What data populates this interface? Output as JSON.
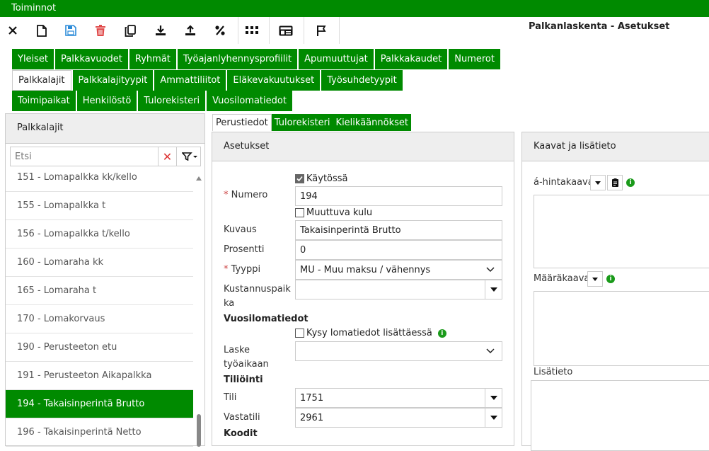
{
  "topbar": {
    "title": "Toiminnot"
  },
  "toolbar": {
    "page_title": "Palkanlaskenta - Asetukset",
    "icons": [
      "close-icon",
      "new-document-icon",
      "save-icon",
      "delete-icon",
      "copy-icon",
      "download-icon",
      "upload-icon",
      "percent-icon",
      "grid-icon",
      "id-card-icon",
      "flag-icon"
    ]
  },
  "nav": {
    "row1": [
      "Yleiset",
      "Palkkavuodet",
      "Ryhmät",
      "Työajanlyhennysprofiilit",
      "Apumuuttujat",
      "Palkkakaudet",
      "Numerot"
    ],
    "row2": [
      "Palkkalajit",
      "Palkkalajityypit",
      "Ammattiliitot",
      "Eläkevakuutukset",
      "Työsuhdetyypit"
    ],
    "row3": [
      "Toimipaikat",
      "Henkilöstö",
      "Tulorekisteri",
      "Vuosilomatiedot"
    ],
    "active": "Palkkalajit"
  },
  "left": {
    "title": "Palkkalajit",
    "search_placeholder": "Etsi",
    "items": [
      "151 - Lomapalkka kk/kello",
      "155 - Lomapalkka t",
      "156 - Lomapalkka t/kello",
      "160 - Lomaraha kk",
      "165 - Lomaraha t",
      "170 - Lomakorvaus",
      "190 - Perusteeton etu",
      "191 - Perusteeton Aikapalkka",
      "194 - Takaisinperintä Brutto",
      "196 - Takaisinperintä Netto"
    ],
    "selected": "194 - Takaisinperintä Brutto"
  },
  "tabs": [
    "Perustiedot",
    "Tulorekisteri",
    "Kielikäännökset"
  ],
  "form": {
    "title": "Asetukset",
    "kaytossa_label": "Käytössä",
    "kaytossa_checked": true,
    "numero_label": "Numero",
    "numero_value": "194",
    "muuttuva_label": "Muuttuva kulu",
    "kuvaus_label": "Kuvaus",
    "kuvaus_value": "Takaisinperintä Brutto",
    "prosentti_label": "Prosentti",
    "prosentti_value": "0",
    "tyyppi_label": "Tyyppi",
    "tyyppi_value": "MU - Muu maksu / vähennys",
    "kustannus_label_1": "Kustannuspaik",
    "kustannus_label_2": "ka",
    "kustannus_value": "",
    "vuosiloma_section": "Vuosilomatiedot",
    "kysy_label": "Kysy lomatiedot lisättäessä",
    "laske_label_1": "Laske",
    "laske_label_2": "työaikaan",
    "laske_value": "",
    "tiliointi_section": "Tiliöinti",
    "tili_label": "Tili",
    "tili_value": "1751",
    "vastatili_label": "Vastatili",
    "vastatili_value": "2961",
    "koodit_section": "Koodit"
  },
  "right": {
    "title": "Kaavat ja lisätieto",
    "hintakaava_label": "á-hintakaava",
    "maarakaava_label": "Määräkaava",
    "lisatieto_label": "Lisätieto"
  },
  "colors": {
    "brand": "#008a00",
    "accent_blue": "#2a8ad8",
    "delete_red": "#e04a4a"
  }
}
